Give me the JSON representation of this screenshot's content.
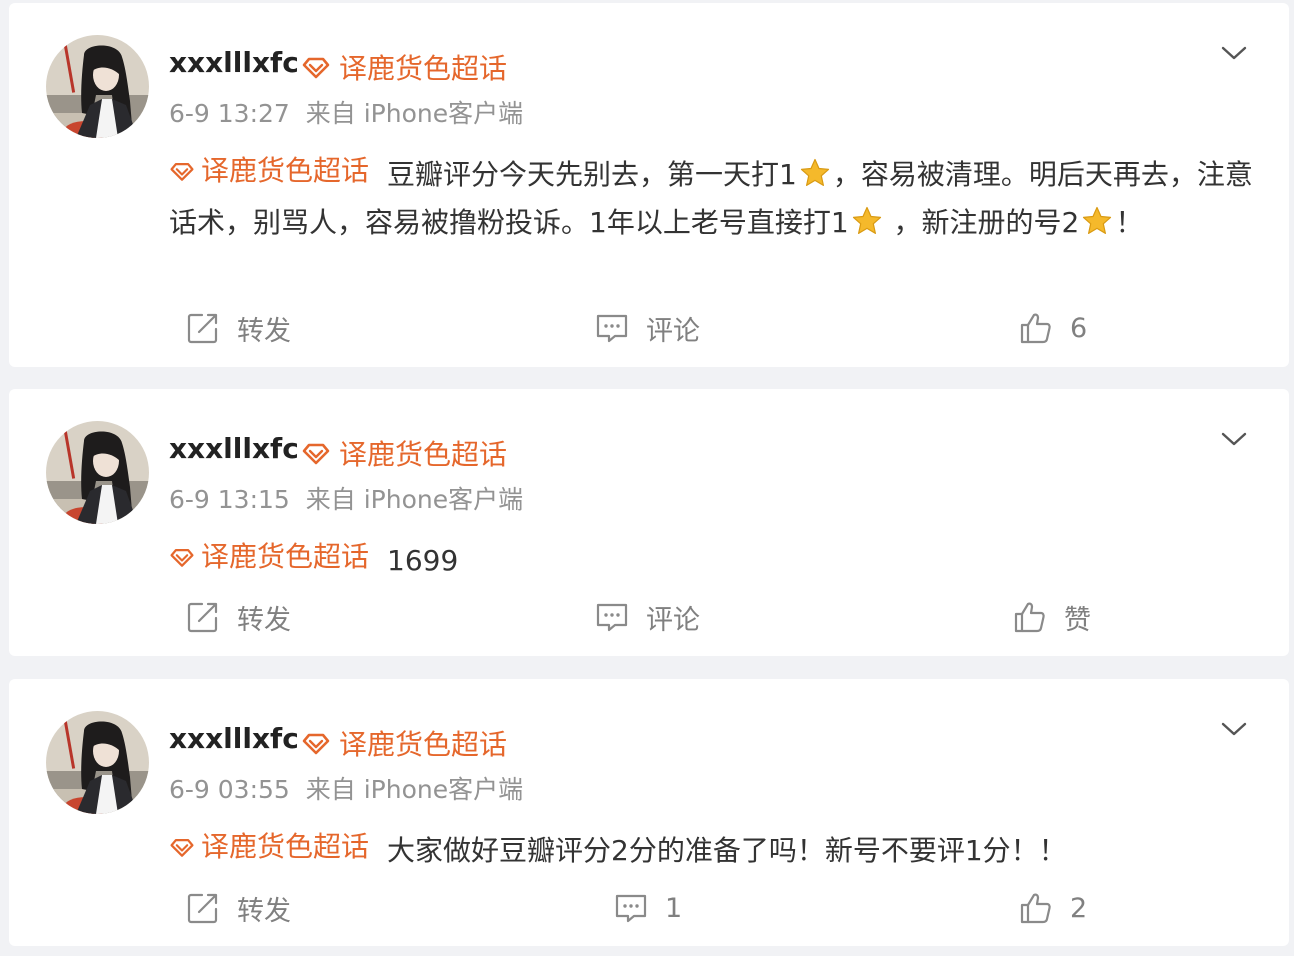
{
  "colors": {
    "background": "#f1f2f5",
    "card": "#ffffff",
    "topic_orange": "#e5672c",
    "meta_gray": "#939393",
    "action_gray": "#808080",
    "star_gold": "#f5b92b"
  },
  "icons": {
    "topic": "diamond-icon",
    "more": "chevron-down-icon",
    "repost": "repost-icon",
    "comment": "comment-icon",
    "like": "thumbs-up-icon",
    "star": "star-emoji"
  },
  "posts": [
    {
      "username": "xxxlllxfc",
      "topic_label": "译鹿货色超话",
      "time": "6-9 13:27",
      "source": "来自 iPhone客户端",
      "body_topic": "译鹿货色超话",
      "body_part1": "豆瓣评分今天先别去，第一天打1",
      "body_part2": "，容易被清理。明后天再去，注意话术，别骂人，容易被撸粉投诉。1年以上老号直接打1",
      "body_part3": " ，新注册的号2",
      "body_part4": "！",
      "repost_label": "转发",
      "comment_label": "评论",
      "like_label": "6"
    },
    {
      "username": "xxxlllxfc",
      "topic_label": "译鹿货色超话",
      "time": "6-9 13:15",
      "source": "来自 iPhone客户端",
      "body_topic": "译鹿货色超话",
      "body_text": "1699",
      "repost_label": "转发",
      "comment_label": "评论",
      "like_label": "赞"
    },
    {
      "username": "xxxlllxfc",
      "topic_label": "译鹿货色超话",
      "time": "6-9 03:55",
      "source": "来自 iPhone客户端",
      "body_topic": "译鹿货色超话",
      "body_text": "大家做好豆瓣评分2分的准备了吗！新号不要评1分！！",
      "repost_label": "转发",
      "comment_label": "1",
      "like_label": "2"
    }
  ]
}
